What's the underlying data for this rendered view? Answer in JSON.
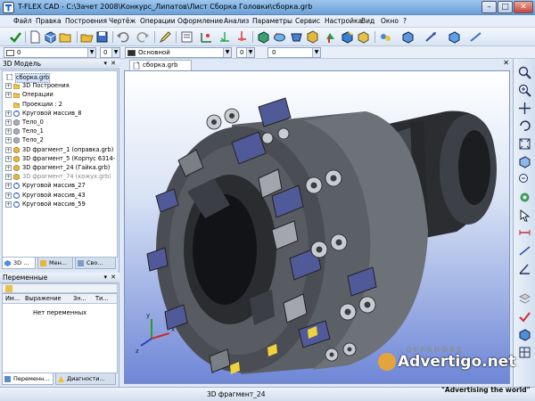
{
  "window": {
    "title": "T-FLEX CAD - C:\\Зачет 2008\\Конкурс_Липатов\\Лист Сборка Головки\\сборка.grb",
    "min_label": "–",
    "max_label": "□",
    "close_label": "✕"
  },
  "menu": [
    "Файл",
    "Правка",
    "Построения",
    "Чертёж",
    "Операции",
    "Оформление",
    "Анализ",
    "Параметры",
    "Сервис",
    "Настройка",
    "Вид",
    "Окно",
    "?"
  ],
  "toolbar2": {
    "layer_value": "0",
    "level_value": "0",
    "style_value": "Основной",
    "color_value": "0",
    "zero_value": "0"
  },
  "left_panel": {
    "title": "3D Модель",
    "pin": "▾",
    "close": "✕",
    "tree": [
      {
        "label": "сборка.grb",
        "level": 0,
        "icon": "document-icon",
        "expand": "",
        "selected": true
      },
      {
        "label": "3D Построения",
        "level": 1,
        "icon": "folder-icon",
        "expand": "+"
      },
      {
        "label": "Операции",
        "level": 1,
        "icon": "folder-icon",
        "expand": "+"
      },
      {
        "label": "Проекции : 2",
        "level": 1,
        "icon": "folder-icon",
        "expand": ""
      },
      {
        "label": "Круговой массив_8",
        "level": 1,
        "icon": "circular-array-icon",
        "expand": "+"
      },
      {
        "label": "Тело_0",
        "level": 1,
        "icon": "body-icon",
        "expand": "+"
      },
      {
        "label": "Тело_1",
        "level": 1,
        "icon": "body-icon",
        "expand": "+"
      },
      {
        "label": "Тело_2",
        "level": 1,
        "icon": "body-icon",
        "expand": "+"
      },
      {
        "label": "3D фрагмент_1 (оправка.grb)",
        "level": 1,
        "icon": "fragment-icon",
        "expand": "+"
      },
      {
        "label": "3D фрагмент_5 (Корпус 6314-",
        "level": 1,
        "icon": "fragment-icon",
        "expand": "+"
      },
      {
        "label": "3D фрагмент_24 (Гайка.grb)",
        "level": 1,
        "icon": "fragment-icon",
        "expand": "+"
      },
      {
        "label": "3D фрагмент_74 (кожух.grb)",
        "level": 1,
        "icon": "fragment-icon",
        "expand": "+",
        "gray": true
      },
      {
        "label": "Круговой массив_27",
        "level": 1,
        "icon": "circular-array-icon",
        "expand": "+"
      },
      {
        "label": "Круговой массив_43",
        "level": 1,
        "icon": "circular-array-icon",
        "expand": "+"
      },
      {
        "label": "Круговой массив_59",
        "level": 1,
        "icon": "circular-array-icon",
        "expand": "+"
      }
    ],
    "tabs": [
      "3D ...",
      "Мен...",
      "Сво..."
    ]
  },
  "variables_panel": {
    "title": "Переменные",
    "columns": [
      "Им...",
      "Выражение",
      "Зн...",
      "Ти..."
    ],
    "empty_text": "Нет переменных",
    "tabs": [
      "Переменн...",
      "Диагности..."
    ]
  },
  "document": {
    "tab_label": "сборка.grb",
    "tab_star": "*",
    "close": "✕"
  },
  "axes": {
    "x": "x",
    "y": "y",
    "z": "z"
  },
  "status": {
    "text": "3D фрагмент_24"
  },
  "watermark": {
    "brand_top": "OFFSHORE",
    "brand_main": "Advertigo.net",
    "slogan": "\"Advertising  the  world\""
  },
  "colors": {
    "title_bar": "#7eaee2",
    "viewport_top": "#ffffff",
    "viewport_bottom": "#6e86d6",
    "model_dark": "#2b2d31",
    "model_mid": "#5b5f66",
    "insert_blue": "#515a99",
    "accent_yellow": "#f2d23c"
  }
}
